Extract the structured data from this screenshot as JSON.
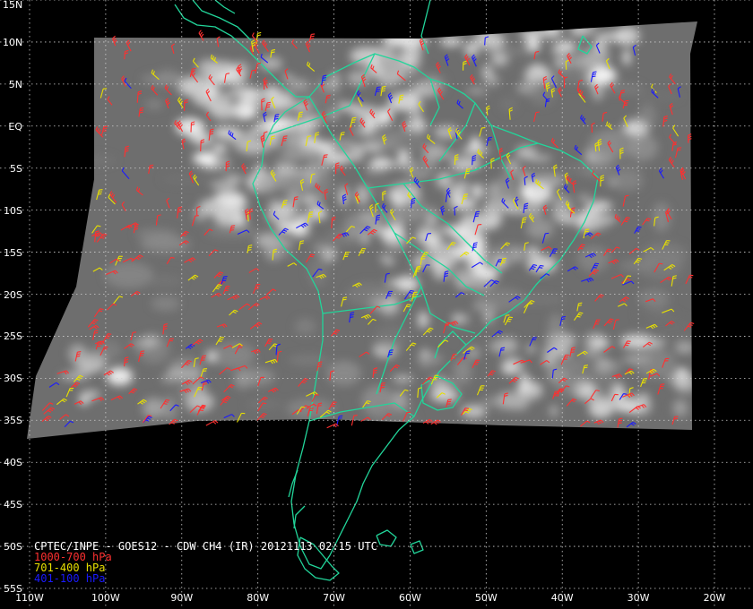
{
  "title": "CPTEC/INPE - GOES12 - CDW CH4 (IR) 20121113 02:15 UTC",
  "legend": [
    {
      "label": "1000-700 hPa",
      "color": "#ff3030"
    },
    {
      "label": "701-400 hPa",
      "color": "#e8e000"
    },
    {
      "label": "401-100 hPa",
      "color": "#1a1aff"
    }
  ],
  "colors": {
    "background": "#000000",
    "coastline": "#22d59a",
    "grid": "#cfcfcf",
    "labels": "#ffffff"
  },
  "lat_labels": [
    "15N",
    "10N",
    "5N",
    "EQ",
    "5S",
    "10S",
    "15S",
    "20S",
    "25S",
    "30S",
    "35S",
    "40S",
    "45S",
    "50S",
    "55S"
  ],
  "lat_values": [
    15,
    10,
    5,
    0,
    -5,
    -10,
    -15,
    -20,
    -25,
    -30,
    -35,
    -40,
    -45,
    -50,
    -55
  ],
  "lon_labels": [
    "110W",
    "100W",
    "90W",
    "80W",
    "70W",
    "60W",
    "50W",
    "40W",
    "30W",
    "20W"
  ],
  "lon_values": [
    -110,
    -100,
    -90,
    -80,
    -70,
    -60,
    -50,
    -40,
    -30,
    -20
  ],
  "imagery_extent": {
    "lon": [
      -110,
      -20
    ],
    "lat": [
      -37,
      11
    ]
  }
}
